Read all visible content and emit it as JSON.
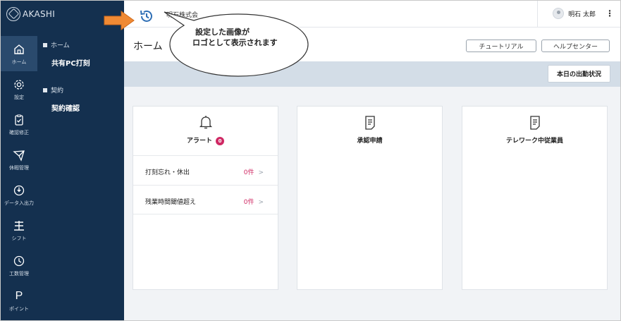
{
  "brand": {
    "name": "AKASHI"
  },
  "topbar": {
    "company": "明石株式会",
    "user_name": "明石 太郎",
    "menu_icon": "more-vertical-icon"
  },
  "rail": [
    {
      "label": "ホーム",
      "icon": "home-icon"
    },
    {
      "label": "設定",
      "icon": "gear-icon"
    },
    {
      "label": "確認修正",
      "icon": "clipboard-check-icon"
    },
    {
      "label": "休暇管理",
      "icon": "plane-icon"
    },
    {
      "label": "データ入出力",
      "icon": "power-icon"
    },
    {
      "label": "シフト",
      "icon": "shift-icon"
    },
    {
      "label": "工数管理",
      "icon": "clock-icon"
    },
    {
      "label": "ポイント",
      "icon": "p-icon"
    }
  ],
  "subnav": {
    "sections": [
      {
        "heading": "ホーム",
        "link": "共有PC打刻"
      },
      {
        "heading": "契約",
        "link": "契約確認"
      }
    ]
  },
  "header": {
    "title": "ホーム",
    "tutorial_label": "チュートリアル",
    "help_label": "ヘルプセンター"
  },
  "band": {
    "status_label": "本日の出勤状況"
  },
  "cards": {
    "alert": {
      "title": "アラート",
      "badge": "0",
      "rows": [
        {
          "label": "打刻忘れ・休出",
          "count": "0件",
          "chevron": ">"
        },
        {
          "label": "残業時間閾値超え",
          "count": "0件",
          "chevron": ">"
        }
      ]
    },
    "approval": {
      "title": "承認申請"
    },
    "telework": {
      "title": "テレワーク中従業員"
    }
  },
  "callout": {
    "line1": "設定した画像が",
    "line2": "ロゴとして表示されます"
  },
  "colors": {
    "sidebar": "#14304f",
    "accent": "#cf2863",
    "band": "#d3dde7",
    "arrow": "#f08a34"
  }
}
